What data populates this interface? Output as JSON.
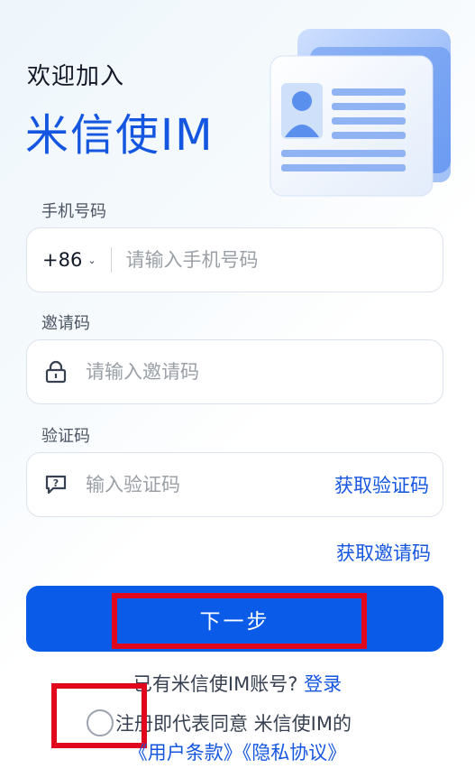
{
  "header": {
    "welcome": "欢迎加入",
    "brand": "米信使IM"
  },
  "phone": {
    "label": "手机号码",
    "country_code": "+86",
    "placeholder": "请输入手机号码"
  },
  "invite": {
    "label": "邀请码",
    "placeholder": "请输入邀请码"
  },
  "verify": {
    "label": "验证码",
    "placeholder": "输入验证码",
    "get_code": "获取验证码"
  },
  "get_invite_code": "获取邀请码",
  "next_button": "下一步",
  "login_prompt": {
    "text": "已有米信使IM账号?",
    "link": "登录"
  },
  "agreement": {
    "text": "注册即代表同意 米信使IM的",
    "user_terms": "《用户条款》",
    "privacy": "《隐私协议》"
  },
  "colors": {
    "accent": "#1556e0",
    "button": "#0a5be8",
    "highlight": "#e1081e"
  }
}
